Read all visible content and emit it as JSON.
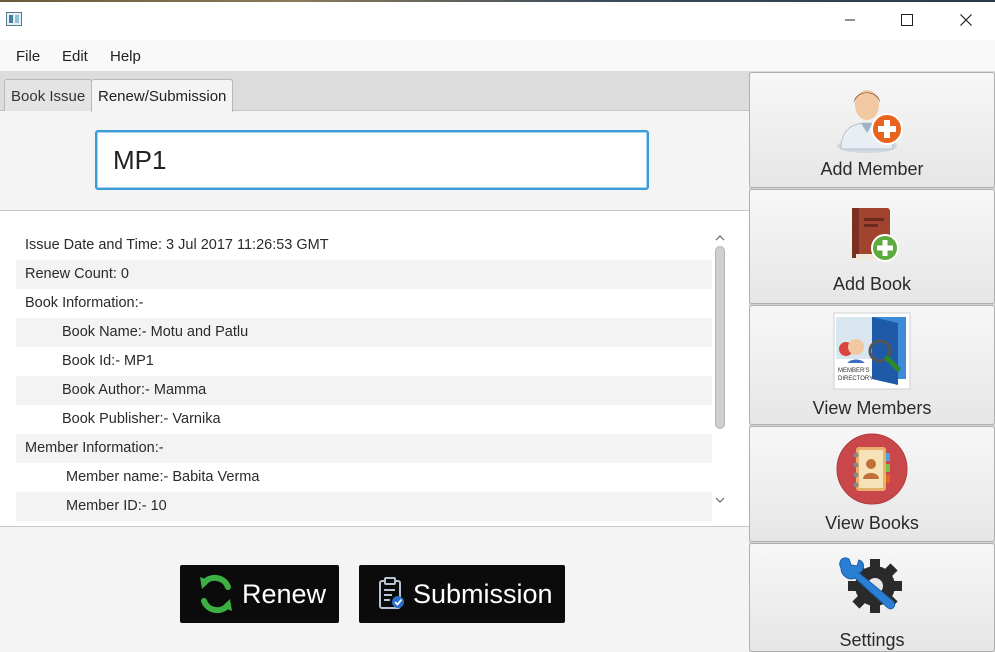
{
  "menu": {
    "file": "File",
    "edit": "Edit",
    "help": "Help"
  },
  "tabs": [
    {
      "label": "Book Issue",
      "active": false
    },
    {
      "label": "Renew/Submission",
      "active": true
    }
  ],
  "search": {
    "value": "MP1"
  },
  "details": [
    "Issue Date and Time: 3 Jul 2017 11:26:53 GMT",
    "Renew Count: 0",
    "Book Information:-",
    "Book Name:- Motu and Patlu",
    "Book Id:- MP1",
    "Book Author:- Mamma",
    "Book Publisher:- Varnika",
    "Member Information:-",
    "Member name:- Babita Verma",
    "Member ID:- 10"
  ],
  "actions": {
    "renew": "Renew",
    "submission": "Submission"
  },
  "sidebar": {
    "add_member": "Add Member",
    "add_book": "Add Book",
    "view_members": "View Members",
    "view_members_icon_text": "MEMBER'S DIRECTORY",
    "view_books": "View Books",
    "settings": "Settings"
  },
  "colors": {
    "accent_focus": "#3a9ad8",
    "button_bg": "#0b0b0b",
    "renew_icon": "#3cb043",
    "add_orange": "#e8641e",
    "add_green": "#5cab3c",
    "view_books_circle": "#c9474b"
  }
}
